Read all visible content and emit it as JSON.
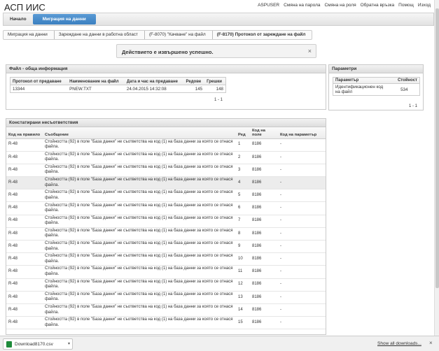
{
  "app": {
    "title": "АСП ИИС"
  },
  "top_links": [
    "ASPUSER",
    "Смяна на парола",
    "Смяна на роля",
    "Обратна връзка",
    "Помощ",
    "Изход"
  ],
  "nav": {
    "tabs": [
      {
        "label": "Начало",
        "active": false
      },
      {
        "label": "Миграция на данни",
        "active": true
      }
    ]
  },
  "breadcrumb": [
    "Миграция на данни",
    "Зареждане на данни в работна област",
    "(F-8070) \"Качване\" на файл",
    "(F-8170) Протокол от зареждане на файл"
  ],
  "alert": {
    "message": "Действието е извършено успешно.",
    "close": "×"
  },
  "file_panel": {
    "title": "Файл - обща информация",
    "columns": [
      "Протокол от предаване",
      "Наименование на файл",
      "Дата и час на предаване",
      "Редове",
      "Грешки"
    ],
    "row": [
      "13344",
      "PNEW.TXT",
      "24.04.2015 14:32:08",
      "145",
      "148"
    ],
    "pager": "1 - 1"
  },
  "param_panel": {
    "title": "Параметри",
    "columns": [
      "Параметър",
      "Стойност"
    ],
    "row": [
      "Идентификационен код на файл",
      "534"
    ],
    "pager": "1 - 1"
  },
  "discrepancies": {
    "title": "Констатирани несъответствия",
    "columns": [
      "Код на правило",
      "Съобщение",
      "Ред",
      "Код на поле",
      "Код на параметър"
    ],
    "rows": [
      [
        "R-48",
        "Стойността (92) в поле \"База данни\" не съответства на код (1) на база данни за която се отнася файла.",
        "1",
        "8186",
        "-"
      ],
      [
        "R-48",
        "Стойността (92) в поле \"База данни\" не съответства на код (1) на база данни за която се отнася файла.",
        "2",
        "8186",
        "-"
      ],
      [
        "R-48",
        "Стойността (92) в поле \"База данни\" не съответства на код (1) на база данни за която се отнася файла.",
        "3",
        "8186",
        "-"
      ],
      [
        "R-48",
        "Стойността (92) в поле \"База данни\" не съответства на код (1) на база данни за която се отнася файла.",
        "4",
        "8186",
        "-"
      ],
      [
        "R-48",
        "Стойността (92) в поле \"База данни\" не съответства на код (1) на база данни за която се отнася файла.",
        "5",
        "8186",
        "-"
      ],
      [
        "R-48",
        "Стойността (92) в поле \"База данни\" не съответства на код (1) на база данни за която се отнася файла.",
        "6",
        "8186",
        "-"
      ],
      [
        "R-48",
        "Стойността (92) в поле \"База данни\" не съответства на код (1) на база данни за която се отнася файла.",
        "7",
        "8186",
        "-"
      ],
      [
        "R-48",
        "Стойността (92) в поле \"База данни\" не съответства на код (1) на база данни за която се отнася файла.",
        "8",
        "8186",
        "-"
      ],
      [
        "R-48",
        "Стойността (92) в поле \"База данни\" не съответства на код (1) на база данни за която се отнася файла.",
        "9",
        "8186",
        "-"
      ],
      [
        "R-48",
        "Стойността (92) в поле \"База данни\" не съответства на код (1) на база данни за която се отнася файла.",
        "10",
        "8186",
        "-"
      ],
      [
        "R-48",
        "Стойността (92) в поле \"База данни\" не съответства на код (1) на база данни за която се отнася файла.",
        "11",
        "8186",
        "-"
      ],
      [
        "R-48",
        "Стойността (92) в поле \"База данни\" не съответства на код (1) на база данни за която се отнася файла.",
        "12",
        "8186",
        "-"
      ],
      [
        "R-48",
        "Стойността (92) в поле \"База данни\" не съответства на код (1) на база данни за която се отнася файла.",
        "13",
        "8186",
        "-"
      ],
      [
        "R-48",
        "Стойността (92) в поле \"База данни\" не съответства на код (1) на база данни за която се отнася файла.",
        "14",
        "8186",
        "-"
      ],
      [
        "R-48",
        "Стойността (92) в поле \"База данни\" не съответства на код (1) на база данни за която се отнася файла.",
        "15",
        "8186",
        "-"
      ]
    ],
    "highlighted_row": 3
  },
  "download_bar": {
    "file": "Download8170.csv",
    "show_all": "Show all downloads...",
    "close": "×"
  }
}
